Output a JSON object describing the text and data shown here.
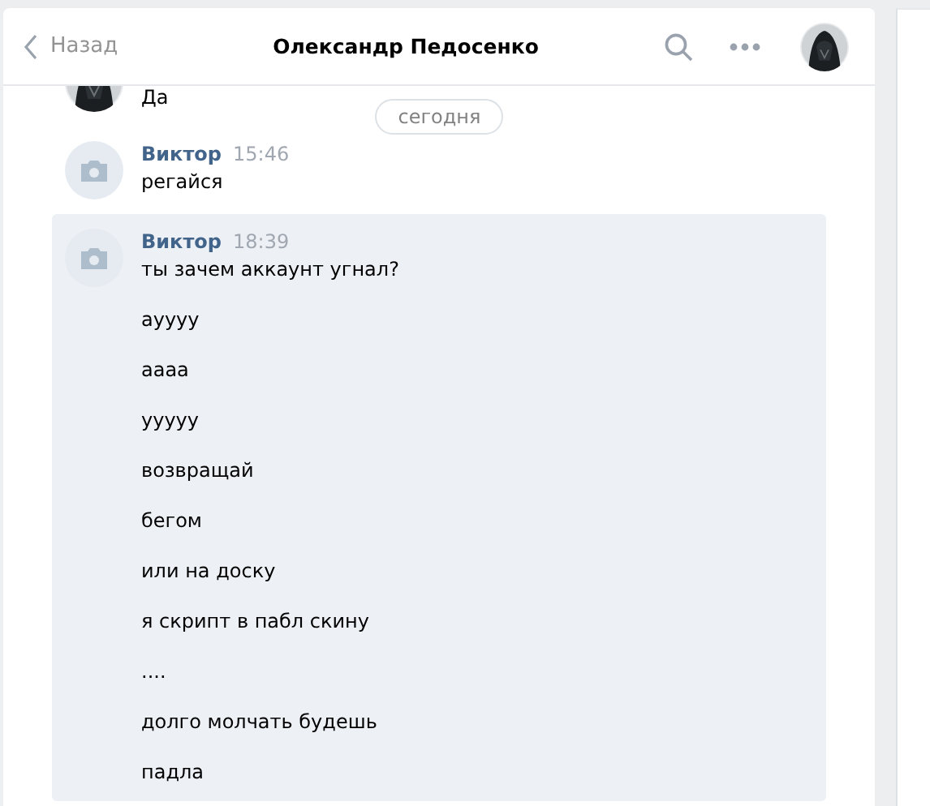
{
  "header": {
    "back_label": "Назад",
    "title": "Олександр Педосенко"
  },
  "messages": [
    {
      "kind": "partial",
      "lines": [
        "Да"
      ],
      "selected": false
    },
    {
      "kind": "divider",
      "label": "сегодня"
    },
    {
      "kind": "message",
      "avatar": {
        "kind": "camera"
      },
      "author": "Виктор",
      "time": "15:46",
      "lines": [
        "регайся"
      ],
      "selected": false
    },
    {
      "kind": "message",
      "avatar": {
        "kind": "camera"
      },
      "author": "Виктор",
      "time": "18:39",
      "lines": [
        "ты зачем аккаунт угнал?",
        "ауууу",
        "аааа",
        "ууууу",
        "возвращай",
        "бегом",
        "или на доску",
        "я скрипт в пабл скину",
        "....",
        "долго молчать будешь",
        "падла"
      ],
      "selected": true
    }
  ]
}
